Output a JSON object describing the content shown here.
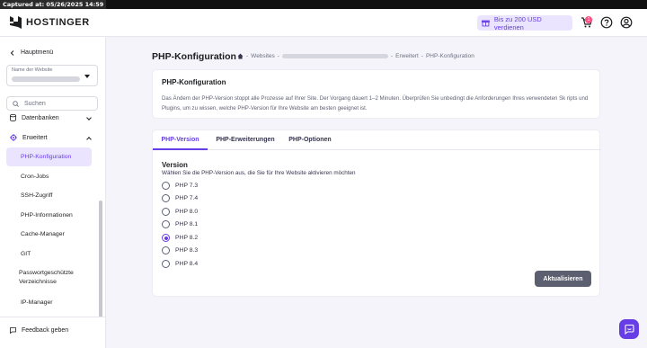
{
  "capture": {
    "text": "Captured at: 05/26/2025 14:59"
  },
  "header": {
    "brand": "HOSTINGER",
    "earn_label": "Bis zu 200 USD verdienen",
    "cart_badge": "1"
  },
  "sidebar": {
    "back_label": "Hauptmenü",
    "site_select_label": "Name der Website",
    "search_placeholder": "Suchen",
    "groups": [
      {
        "label": "Datenbanken"
      },
      {
        "label": "Erweitert"
      }
    ],
    "items": [
      {
        "label": "PHP-Konfiguration",
        "active": true
      },
      {
        "label": "Cron-Jobs"
      },
      {
        "label": "SSH-Zugriff"
      },
      {
        "label": "PHP-Informationen"
      },
      {
        "label": "Cache-Manager"
      },
      {
        "label": "GIT"
      },
      {
        "label": "Passwortgeschützte"
      },
      {
        "label": "Verzeichnisse"
      },
      {
        "label": "IP-Manager"
      }
    ],
    "feedback_label": "Feedback geben"
  },
  "main": {
    "title": "PHP-Konfiguration",
    "breadcrumb": {
      "sep": "-",
      "websites": "Websites",
      "advanced": "Erweitert",
      "current": "PHP-Konfiguration"
    },
    "info_card": {
      "title": "PHP-Konfiguration",
      "description": "Das Ändern der PHP-Version stoppt alle Prozesse auf Ihrer Site. Der Vorgang dauert 1–2 Minuten. Überprüfen Sie unbedingt die Anforderungen Ihres verwendeten Sk ripts und Plugins, um zu wissen, welche PHP-Version für Ihre Website am besten geeignet ist."
    },
    "tabs": [
      {
        "label": "PHP-Version",
        "active": true
      },
      {
        "label": "PHP-Erweiterungen"
      },
      {
        "label": "PHP-Optionen"
      }
    ],
    "version": {
      "title": "Version",
      "subtitle": "Wählen Sie die PHP-Version aus, die Sie für Ihre Website aktivieren möchten",
      "options": [
        "PHP 7.3",
        "PHP 7.4",
        "PHP 8.0",
        "PHP 8.1",
        "PHP 8.2",
        "PHP 8.3",
        "PHP 8.4"
      ],
      "selected": "PHP 8.2"
    },
    "update_button": "Aktualisieren"
  },
  "colors": {
    "brand": "#673de6",
    "brand_light": "#ebe4ff",
    "badge": "#fc5185",
    "button_disabled": "#5c5f70"
  }
}
